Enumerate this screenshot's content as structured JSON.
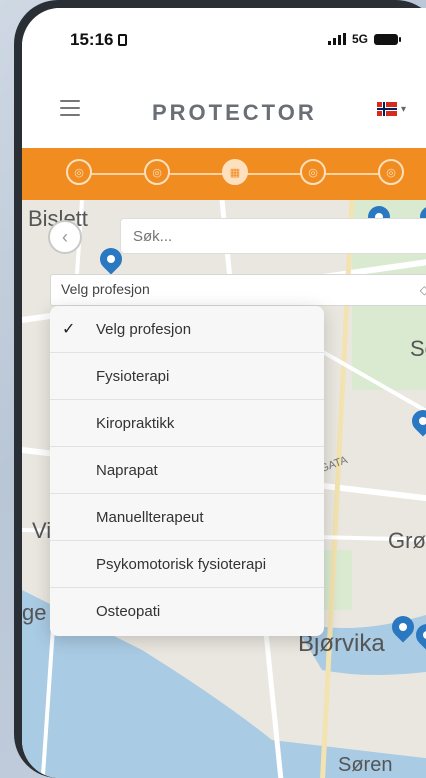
{
  "status": {
    "time": "15:16",
    "network": "5G"
  },
  "header": {
    "brand": "PROTECTOR"
  },
  "progress": {
    "steps": 5,
    "active_index": 2
  },
  "map": {
    "labels": [
      "Bislett",
      "Sof",
      "Vi",
      "Grøn",
      "ge",
      "Bjørvika",
      "Søren",
      "RGATA"
    ]
  },
  "search": {
    "placeholder": "Søk..."
  },
  "profession": {
    "selected": "Velg profesjon",
    "options": [
      "Velg profesjon",
      "Fysioterapi",
      "Kiropraktikk",
      "Naprapat",
      "Manuellterapeut",
      "Psykomotorisk fysioterapi",
      "Osteopati"
    ]
  }
}
